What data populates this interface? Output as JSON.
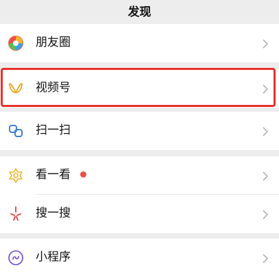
{
  "header": {
    "title": "发现"
  },
  "items": [
    {
      "label": "朋友圈"
    },
    {
      "label": "视频号"
    },
    {
      "label": "扫一扫"
    },
    {
      "label": "看一看"
    },
    {
      "label": "搜一搜"
    },
    {
      "label": "小程序"
    }
  ],
  "colors": {
    "background": "#ededed",
    "row": "#ffffff",
    "highlight": "#e8302a",
    "badge": "#e8504d"
  }
}
